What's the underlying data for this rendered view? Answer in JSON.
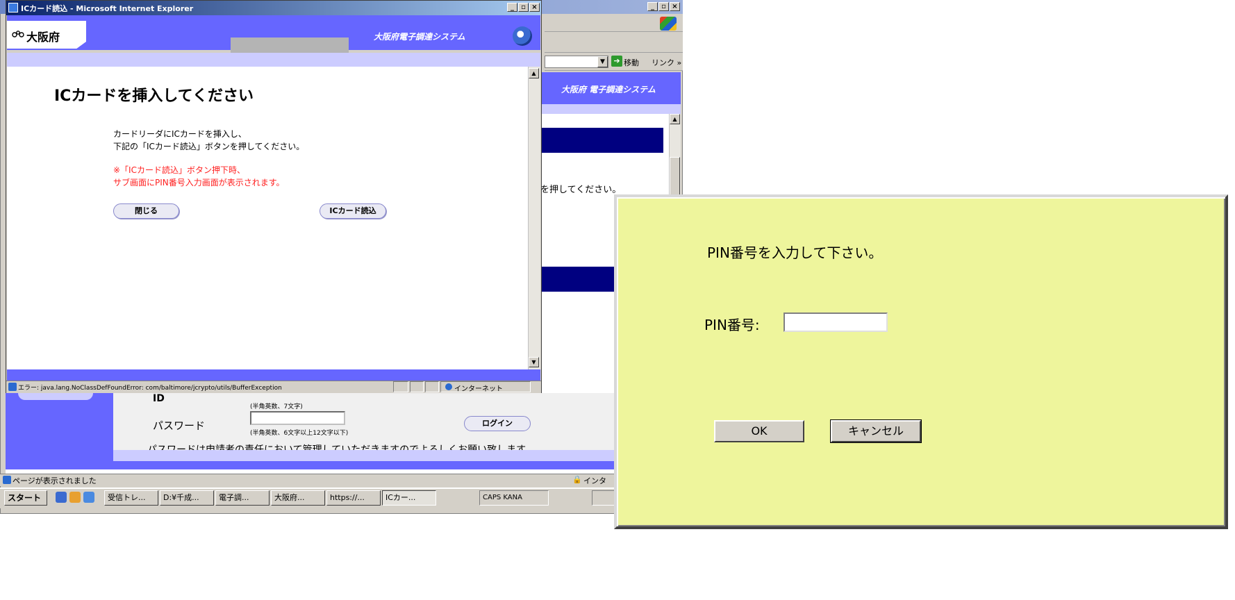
{
  "background_window": {
    "toolbar": {
      "go_label": "移動",
      "links_label": "リンク »"
    },
    "header": {
      "system_title": "大阪府 電子調達システム"
    },
    "partial_instruction": "を押してください。",
    "login_form": {
      "id_label": "ID",
      "id_hint": "(半角英数、7文字)",
      "password_label": "パスワード",
      "password_hint": "(半角英数、6文字以上12文字以下)",
      "login_button": "ログイン",
      "cutoff_text": "パスワードは申請者の責任において管理していただきますのでよろしくお願い致します。"
    },
    "status_bar": {
      "text": "ページが表示されました",
      "zone": "インタ"
    },
    "taskbar": {
      "start": "スタート",
      "tasks": [
        "受信トレ...",
        "D:¥千成...",
        "電子調...",
        "大阪府...",
        "https://...",
        "ICカー..."
      ],
      "tray_text": "CAPS KANA"
    }
  },
  "ic_window": {
    "title": "ICカード読込 - Microsoft Internet Explorer",
    "org_logo_text": "大阪府",
    "system_title": "大阪府電子調達システム",
    "heading": "ICカードを挿入してください",
    "instructions": [
      "カードリーダにICカードを挿入し、",
      "下記の「ICカード読込」ボタンを押してください。"
    ],
    "notes": [
      "※「ICカード読込」ボタン押下時、",
      "サブ画面にPIN番号入力画面が表示されます。"
    ],
    "buttons": {
      "close": "閉じる",
      "read_card": "ICカード読込"
    },
    "status_bar": {
      "text": "エラー: java.lang.NoClassDefFoundError: com/baltimore/jcrypto/utils/BufferException",
      "zone": "インターネット"
    }
  },
  "pin_dialog": {
    "prompt": "PIN番号を入力して下さい。",
    "pin_label": "PIN番号:",
    "pin_value": "",
    "ok_label": "OK",
    "cancel_label": "キャンセル"
  },
  "colors": {
    "header_blue": "#6666ff",
    "light_strip": "#ccccff",
    "navy": "#000080",
    "note_red": "#ff2020",
    "pin_background": "#eef59c"
  }
}
